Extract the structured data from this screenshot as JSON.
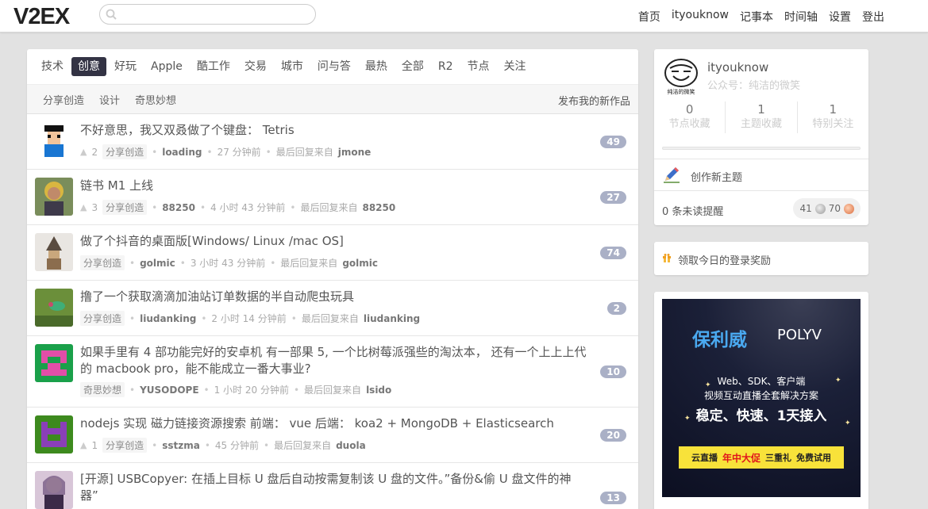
{
  "header": {
    "logo": "V2EX",
    "search_placeholder": "",
    "nav": [
      "首页",
      "ityouknow",
      "记事本",
      "时间轴",
      "设置",
      "登出"
    ]
  },
  "tabs": [
    {
      "label": "技术",
      "active": false
    },
    {
      "label": "创意",
      "active": true
    },
    {
      "label": "好玩",
      "active": false
    },
    {
      "label": "Apple",
      "active": false
    },
    {
      "label": "酷工作",
      "active": false
    },
    {
      "label": "交易",
      "active": false
    },
    {
      "label": "城市",
      "active": false
    },
    {
      "label": "问与答",
      "active": false
    },
    {
      "label": "最热",
      "active": false
    },
    {
      "label": "全部",
      "active": false
    },
    {
      "label": "R2",
      "active": false
    },
    {
      "label": "节点",
      "active": false
    },
    {
      "label": "关注",
      "active": false
    }
  ],
  "subtabs": {
    "items": [
      "分享创造",
      "设计",
      "奇思妙想"
    ],
    "publish": "发布我的新作品"
  },
  "topics": [
    {
      "title": "不好意思，我又双叒做了个键盘： Tetris",
      "votes": "2",
      "node": "分享创造",
      "author": "loading",
      "time": "27 分钟前",
      "last_label": "最后回复来自",
      "last_user": "jmone",
      "replies": "49"
    },
    {
      "title": "链书 M1 上线",
      "votes": "3",
      "node": "分享创造",
      "author": "88250",
      "time": "4 小时 43 分钟前",
      "last_label": "最后回复来自",
      "last_user": "88250",
      "replies": "27"
    },
    {
      "title": "做了个抖音的桌面版[Windows/ Linux /mac OS]",
      "votes": "",
      "node": "分享创造",
      "author": "golmic",
      "time": "3 小时 43 分钟前",
      "last_label": "最后回复来自",
      "last_user": "golmic",
      "replies": "74"
    },
    {
      "title": "撸了一个获取滴滴加油站订单数据的半自动爬虫玩具",
      "votes": "",
      "node": "分享创造",
      "author": "liudanking",
      "time": "2 小时 14 分钟前",
      "last_label": "最后回复来自",
      "last_user": "liudanking",
      "replies": "2"
    },
    {
      "title": "如果手里有 4 部功能完好的安卓机 有一部果 5, 一个比树莓派强些的淘汰本， 还有一个上上上代的 macbook pro，能不能成立一番大事业?",
      "votes": "",
      "node": "奇思妙想",
      "author": "YUSODOPE",
      "time": "1 小时 20 分钟前",
      "last_label": "最后回复来自",
      "last_user": "lsido",
      "replies": "10"
    },
    {
      "title": "nodejs 实现 磁力链接资源搜索 前端： vue 后端： koa2 + MongoDB + Elasticsearch",
      "votes": "1",
      "node": "分享创造",
      "author": "sstzma",
      "time": "45 分钟前",
      "last_label": "最后回复来自",
      "last_user": "duola",
      "replies": "20"
    },
    {
      "title": "[开源] USBCopyer: 在插上目标 U 盘后自动按需复制该 U 盘的文件。”备份&偷 U 盘文件的神器”",
      "votes": "",
      "node": "",
      "author": "",
      "time": "",
      "last_label": "",
      "last_user": "",
      "replies": "13"
    }
  ],
  "profile": {
    "avatar_caption": "纯洁的微笑",
    "name": "ityouknow",
    "motto": "公众号：纯洁的微笑",
    "stats": [
      {
        "num": "0",
        "label": "节点收藏"
      },
      {
        "num": "1",
        "label": "主题收藏"
      },
      {
        "num": "1",
        "label": "特别关注"
      }
    ],
    "create_label": "创作新主题",
    "notifications": "0 条未读提醒",
    "silver": "41",
    "bronze": "70"
  },
  "reward": {
    "label": "领取今日的登录奖励"
  },
  "ad": {
    "brand_cn": "保利威",
    "brand_en": "POLYV",
    "line1": "Web、SDK、客户端",
    "line2": "视频互动直播全套解决方案",
    "line3": "稳定、快速、1天接入",
    "cta_pre": "云直播",
    "cta_hot": "年中大促",
    "cta_mid": "三重礼",
    "cta_post": "免费试用"
  }
}
